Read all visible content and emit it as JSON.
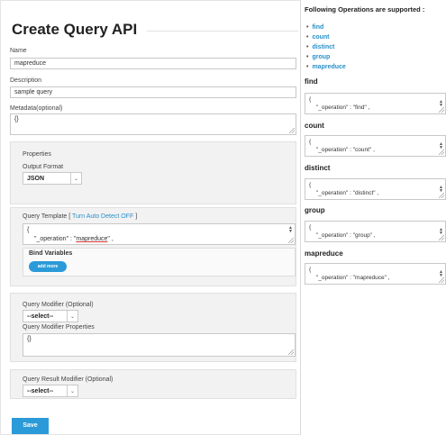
{
  "page": {
    "title": "Create Query API"
  },
  "form": {
    "name_label": "Name",
    "name_value": "mapreduce",
    "description_label": "Description",
    "description_value": "sample query",
    "metadata_label": "Metadata(optional)",
    "metadata_value": "{}",
    "properties_title": "Properties",
    "output_format_label": "Output Format",
    "output_format_value": "JSON",
    "query_template_label": "Query Template [",
    "turn_auto_detect_link": "Turn Auto Detect OFF",
    "query_template_close": "]",
    "query_template_line1": "{",
    "query_template_line2_prefix": "\"_operation\" : \"",
    "query_template_line2_value": "mapreduce",
    "query_template_line2_suffix": "\" ,",
    "bind_variables_title": "Bind Variables",
    "add_more_label": "add more",
    "query_modifier_label": "Query Modifier (Optional)",
    "query_modifier_value": "--select--",
    "query_modifier_properties_label": "Query Modifier Properties",
    "query_modifier_properties_value": "{}",
    "query_result_modifier_label": "Query Result Modifier (Optional)",
    "query_result_modifier_value": "--select--",
    "save_label": "Save"
  },
  "operations": {
    "heading": "Following Operations are supported :",
    "list": [
      "find",
      "count",
      "distinct",
      "group",
      "mapreduce"
    ],
    "samples": [
      {
        "title": "find",
        "line1": "{",
        "line2": "\"_operation\" : \"find\" ,"
      },
      {
        "title": "count",
        "line1": "{",
        "line2": "\"_operation\" : \"count\" ,"
      },
      {
        "title": "distinct",
        "line1": "{",
        "line2": "\"_operation\" : \"distinct\" ,"
      },
      {
        "title": "group",
        "line1": "{",
        "line2": "\"_operation\" : \"group\" ,"
      },
      {
        "title": "mapreduce",
        "line1": "{",
        "line2": "\"_operation\" : \"mapreduce\" ,"
      }
    ]
  },
  "colors": {
    "accent": "#2b9ad8",
    "link": "#2a8fc9",
    "panel": "#f2f2f2"
  }
}
